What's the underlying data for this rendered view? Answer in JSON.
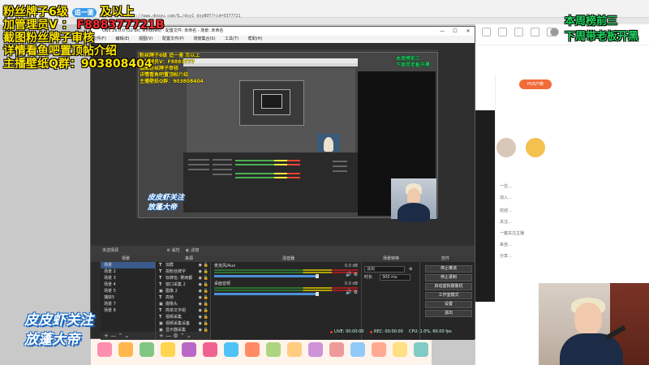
{
  "browser": {
    "url": "https://www.douyu.com/6…/dsy1_dsyBOT?rid=5377721"
  },
  "obs": {
    "window_title": "OBS 26.0.0 (32-bit, windows) - 配置文件: 未命名 - 场景: 未命名",
    "window_buttons": {
      "minimize": "—",
      "maximize": "☐",
      "close": "✕"
    },
    "menu": [
      "文件(F)",
      "编辑(E)",
      "视图(V)",
      "配置文件(P)",
      "场景集合(S)",
      "工具(T)",
      "帮助(H)"
    ],
    "scene_toolbar": {
      "label": "未选择源",
      "properties": "属性",
      "filters": "滤镜"
    },
    "dock_headers": {
      "scenes": "场景",
      "sources": "来源",
      "mixer": "混音器",
      "transitions": "场景转换",
      "controls": "控件"
    },
    "scenes": [
      "场景",
      "场景 2",
      "场景 3",
      "场景 4",
      "场景 5",
      "捕获5",
      "场景 7",
      "场景 8"
    ],
    "sources": [
      {
        "type": "T",
        "name": "加群"
      },
      {
        "type": "T",
        "name": "捐粉丝牌字"
      },
      {
        "type": "T",
        "name": "标牌名: 雾雨都"
      },
      {
        "type": "T",
        "name": "窗口采集 2"
      },
      {
        "type": "▣",
        "name": "图像 2"
      },
      {
        "type": "T",
        "name": "高帧"
      },
      {
        "type": "▣",
        "name": "摄像头"
      },
      {
        "type": "T",
        "name": "简单文字组"
      },
      {
        "type": "T",
        "name": "视频采集"
      },
      {
        "type": "▣",
        "name": "视频采集设备"
      },
      {
        "type": "▣",
        "name": "显示器采集"
      }
    ],
    "mixer": [
      {
        "name": "麦克风/Aux",
        "db": "0.0 dB"
      },
      {
        "name": "桌面音频",
        "db": "0.0 dB"
      }
    ],
    "transitions": {
      "type": "淡出",
      "duration_label": "时长",
      "duration": "300 ms"
    },
    "controls": [
      "停止推流",
      "停止录制",
      "启动虚拟摄像机",
      "工作室模式",
      "设置",
      "退出"
    ],
    "dock_footer": {
      "scenes": "+ —   ⌃ ⌄",
      "sources": "+ — ⚙ ⌃ ⌄"
    },
    "status": {
      "live": "LIVE: 00:00:00",
      "rec": "REC: 00:00:00",
      "cpu": "CPU: 1.0%, 60.00 fps"
    }
  },
  "overlays": {
    "fan_badge_line": {
      "before": "粉丝牌子6级",
      "badge": "追一鉴",
      "after": "及以上"
    },
    "admin_line": {
      "label": "加管理员V",
      "separator": "：",
      "value": "F888377721B"
    },
    "screenshot_line": "截图粉丝牌子审核",
    "details_line": "详情看鱼吧置顶帖介绍",
    "wallpaper_line": "主播壁纸Q群：903808404",
    "weekly_top": "本周榜前三",
    "weekly_reward": "下周带老板开黑",
    "caption_follow": "皮皮虾关注",
    "caption_emperor": "放蓬大帝"
  },
  "nested_preview": {
    "lines": [
      "粉丝牌子6级 追一鉴 及以上",
      "加管理员V：F8883777",
      "截图粉丝牌子审核",
      "详情看鱼吧置顶帖介绍",
      "主播壁纸Q群：903808404"
    ],
    "right": [
      "本周榜前三",
      "下周带老板开黑"
    ],
    "caption_follow": "皮皮虾关注",
    "caption_emperor": "放蓬大帝"
  },
  "web_page": {
    "pos_button": "POS户籍",
    "chat_lines": [
      "一位…",
      "加入…",
      "欢迎…",
      "关注…",
      "一键关注主播",
      "来自…",
      "分享…"
    ]
  },
  "colors": {
    "overlay_yellow": "#ffe600",
    "overlay_green": "#1ed760",
    "overlay_red": "#ff2a2a",
    "obs_dark": "#2b2b2b",
    "selection_blue": "#3a5b8c",
    "caption_blue": "#1565c0"
  }
}
